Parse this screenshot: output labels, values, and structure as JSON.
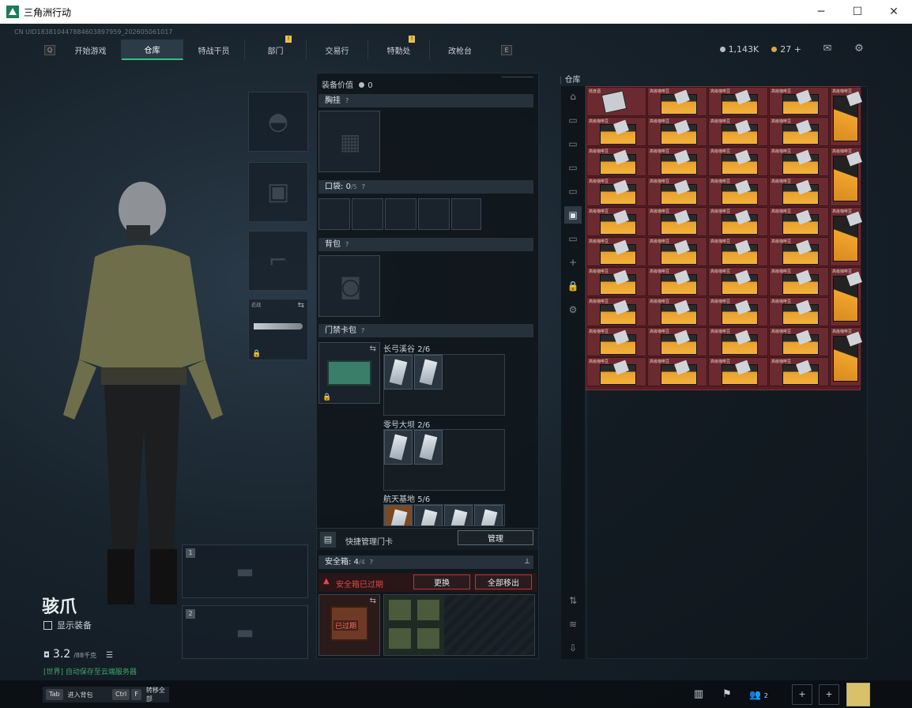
{
  "window": {
    "title": "三角洲行动"
  },
  "uid": "CN UID1838104478846038979​59_202605061017",
  "nav": {
    "left_key": "Q",
    "right_key": "E",
    "tabs": [
      "开始游戏",
      "仓库",
      "特战干员",
      "部门",
      "交易行",
      "特勤处",
      "改枪台"
    ],
    "active": "仓库"
  },
  "currency": {
    "silver": "1,143K",
    "gold": "27"
  },
  "equipment": {
    "value_label": "装备价值",
    "value": "0",
    "chest_rig": "胸挂",
    "pockets_label": "口袋:",
    "pockets_count": "0",
    "pockets_max": "/5",
    "backpack": "背包",
    "keycard": "门禁卡包",
    "keycard_groups": [
      {
        "name": "长弓溪谷",
        "count": "2/6"
      },
      {
        "name": "零号大坝",
        "count": "2/6"
      },
      {
        "name": "航天基地",
        "count": "5/6"
      }
    ],
    "quick_manage": "快捷管理门卡",
    "manage_btn": "管理",
    "safe_box_label": "安全箱:",
    "safe_box_count": "4",
    "safe_box_max": "/4",
    "expired_warning": "安全箱已过期",
    "replace_btn": "更换",
    "remove_all_btn": "全部移出",
    "expired_tag": "已过期",
    "melee_label": "近战"
  },
  "stash": {
    "title": "仓库",
    "item_label": "高级咖啡豆",
    "first_item_label": "低度酒",
    "colors": {
      "bg": "#5a1e24",
      "accent": "#f2b240"
    }
  },
  "weapon_slots": [
    "1",
    "2"
  ],
  "character": {
    "name": "骇爪",
    "show_equip": "显示装备",
    "level": "3.2",
    "level_suffix": "/88千克",
    "chat_channel": "[世界]",
    "chat_text": "自动保存至云端服务器"
  },
  "bottom": {
    "tab_key": "Tab",
    "tab_label": "进入背包",
    "ctrl_key": "Ctrl",
    "f_key": "F",
    "ctrl_label": "转移全部",
    "friends_count": "2"
  }
}
